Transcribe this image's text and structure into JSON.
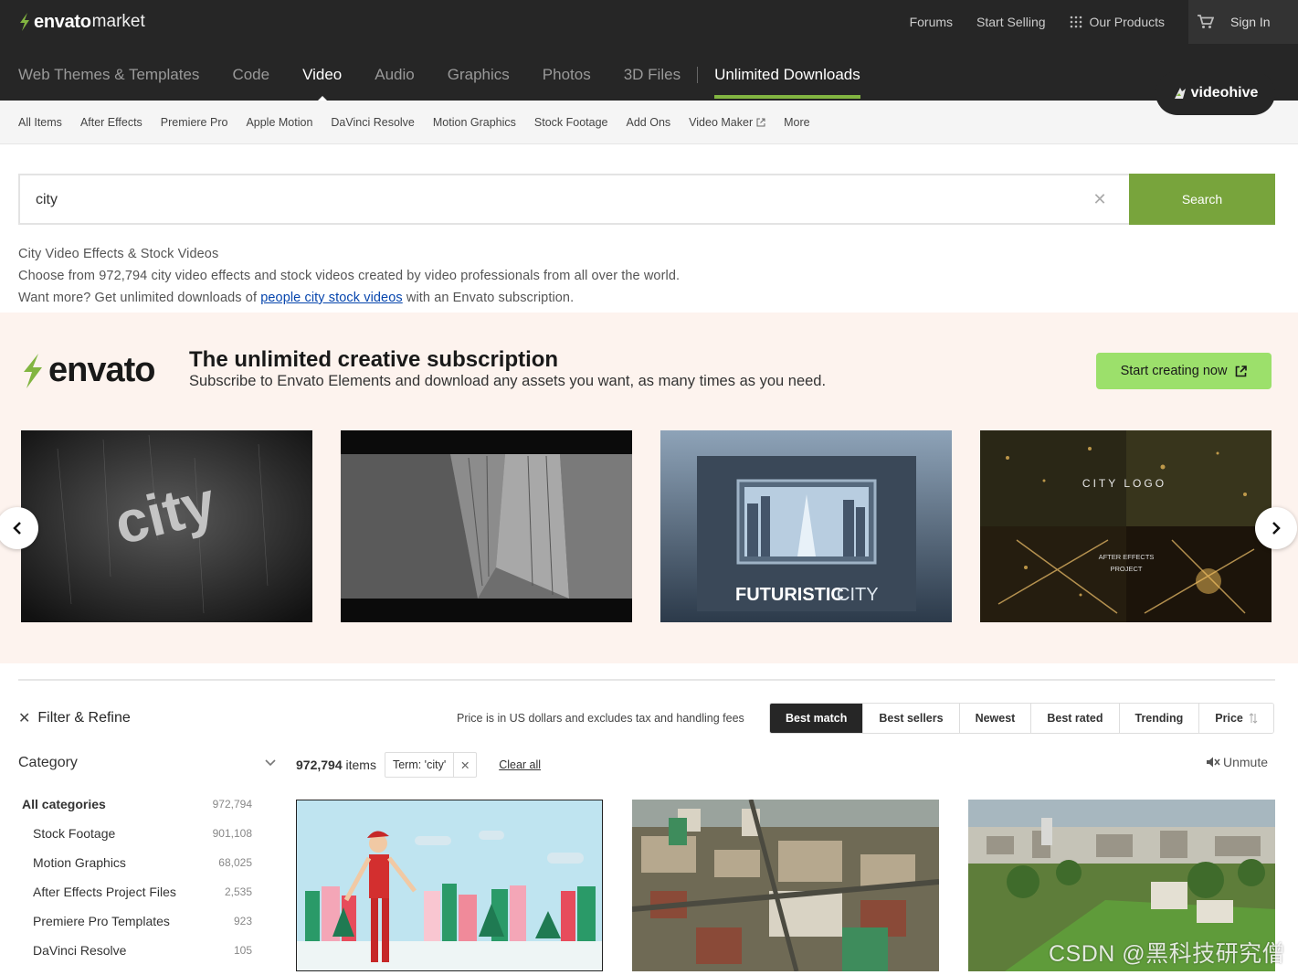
{
  "header": {
    "brand": "envato",
    "brand_suffix": "market",
    "links": [
      "Forums",
      "Start Selling",
      "Our Products"
    ],
    "sign_in": "Sign In"
  },
  "category_nav": {
    "items": [
      "Web Themes & Templates",
      "Code",
      "Video",
      "Audio",
      "Graphics",
      "Photos",
      "3D Files"
    ],
    "active": "Video",
    "unlimited": "Unlimited Downloads"
  },
  "site_badge": "videohive",
  "subnav": [
    "All Items",
    "After Effects",
    "Premiere Pro",
    "Apple Motion",
    "DaVinci Resolve",
    "Motion Graphics",
    "Stock Footage",
    "Add Ons",
    "Video Maker",
    "More"
  ],
  "search": {
    "value": "city",
    "button": "Search"
  },
  "intro": {
    "heading": "City Video Effects & Stock Videos",
    "description": "Choose from 972,794 city video effects and stock videos created by video professionals from all over the world.",
    "more_prefix": "Want more? Get unlimited downloads of ",
    "more_link": "people city stock videos",
    "more_suffix": " with an Envato subscription."
  },
  "promo": {
    "logo": "envato",
    "title": "The unlimited creative subscription",
    "subtitle": "Subscribe to Envato Elements and download any assets you want, as many times as you need.",
    "button": "Start creating now",
    "slides": [
      {
        "text": "city"
      },
      {
        "text": ""
      },
      {
        "text_bold": "FUTURISTIC",
        "text_light": "CITY"
      },
      {
        "text": "CITY LOGO",
        "subtext1": "AFTER EFFECTS",
        "subtext2": "PROJECT"
      }
    ]
  },
  "results": {
    "filter_label": "Filter & Refine",
    "price_note": "Price is in US dollars and excludes tax and handling fees",
    "sort_options": [
      "Best match",
      "Best sellers",
      "Newest",
      "Best rated",
      "Trending",
      "Price"
    ],
    "active_sort": "Best match",
    "count": "972,794",
    "count_suffix": "items",
    "term_chip": "Term: 'city'",
    "clear_all": "Clear all",
    "unmute": "Unmute"
  },
  "sidebar": {
    "heading": "Category",
    "categories": [
      {
        "label": "All categories",
        "count": "972,794"
      },
      {
        "label": "Stock Footage",
        "count": "901,108"
      },
      {
        "label": "Motion Graphics",
        "count": "68,025"
      },
      {
        "label": "After Effects Project Files",
        "count": "2,535"
      },
      {
        "label": "Premiere Pro Templates",
        "count": "923"
      },
      {
        "label": "DaVinci Resolve",
        "count": "105"
      }
    ]
  },
  "watermark": "CSDN @黑科技研究僧",
  "colors": {
    "header_bg": "#262626",
    "accent_green": "#82b541",
    "search_button": "#78a43c",
    "promo_bg": "#fdf3ee",
    "promo_button": "#9ce06b"
  }
}
